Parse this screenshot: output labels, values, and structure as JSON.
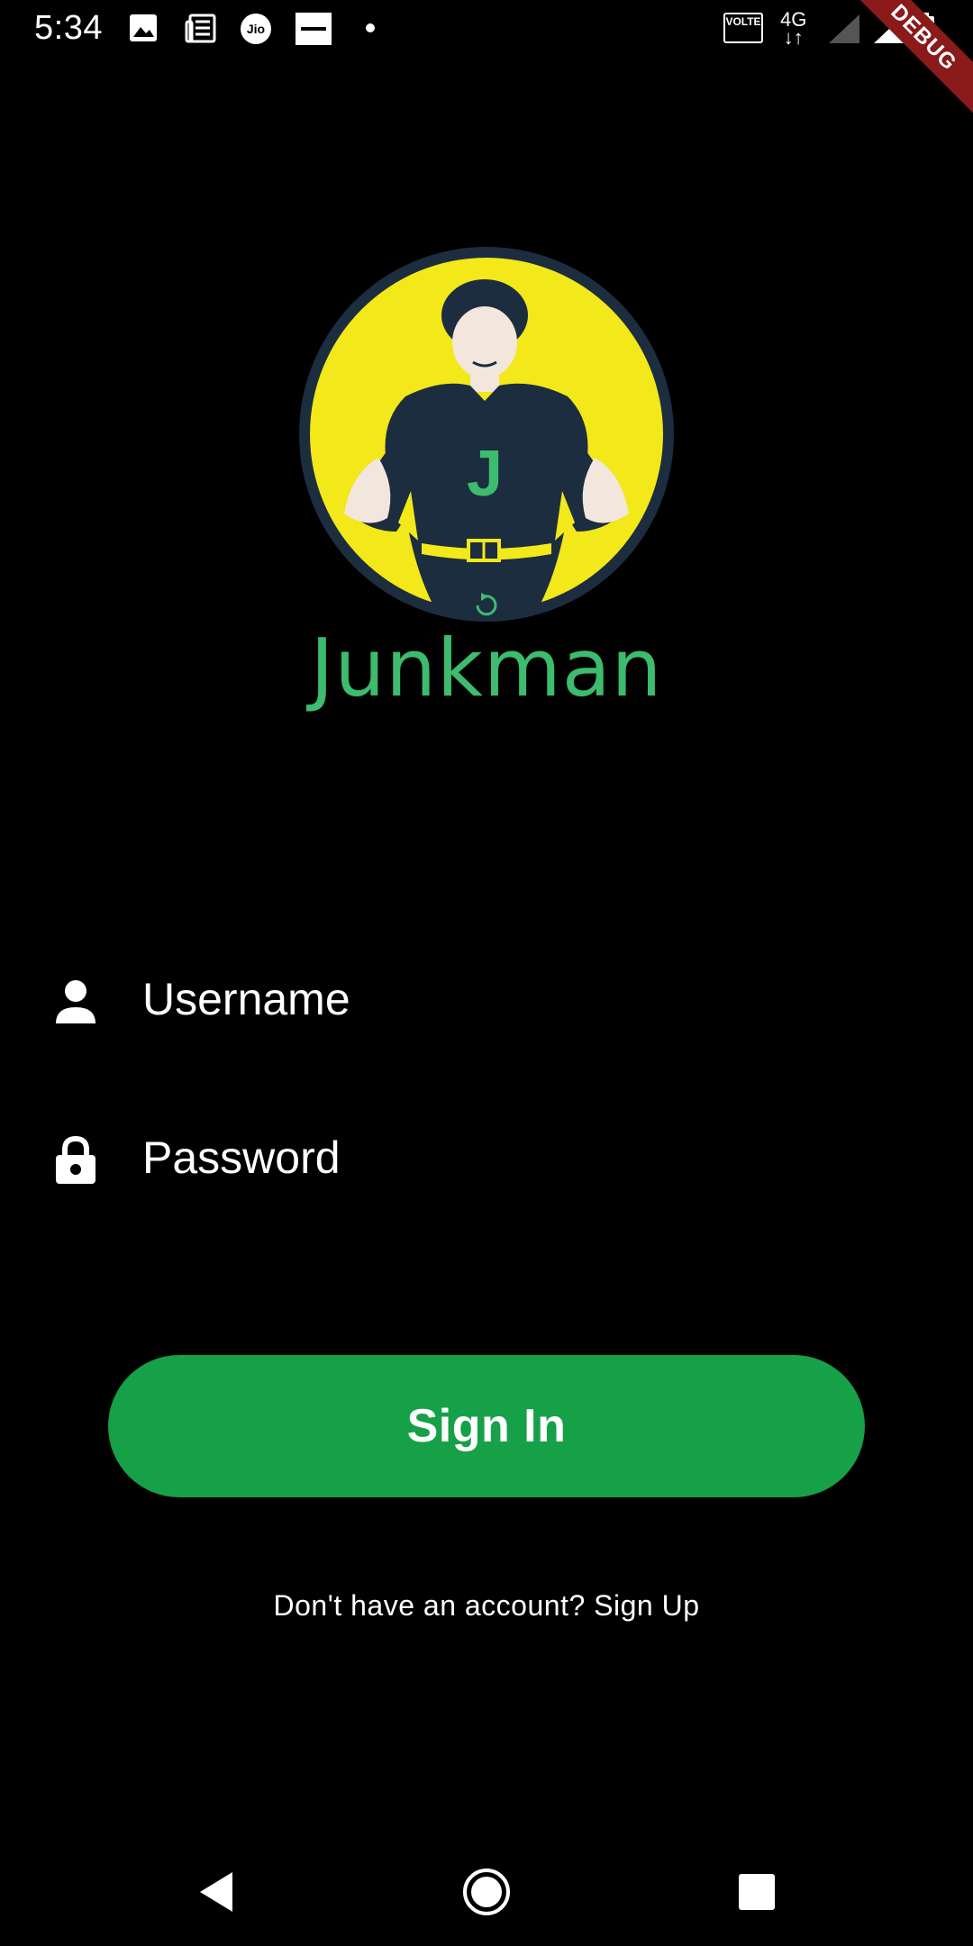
{
  "status_bar": {
    "time": "5:34",
    "volte": "VOLTE",
    "network": "4G",
    "debug": "DEBUG"
  },
  "brand": {
    "name": "Junkman",
    "logo_letter": "J",
    "colors": {
      "yellow": "#f2e81a",
      "navy": "#1c2d3f",
      "green": "#3dbb6e"
    }
  },
  "form": {
    "username_placeholder": "Username",
    "password_placeholder": "Password",
    "signin_label": "Sign In",
    "signup_prompt": "Don't have an account? Sign Up"
  },
  "colors": {
    "accent": "#16a048",
    "background": "#000000"
  }
}
